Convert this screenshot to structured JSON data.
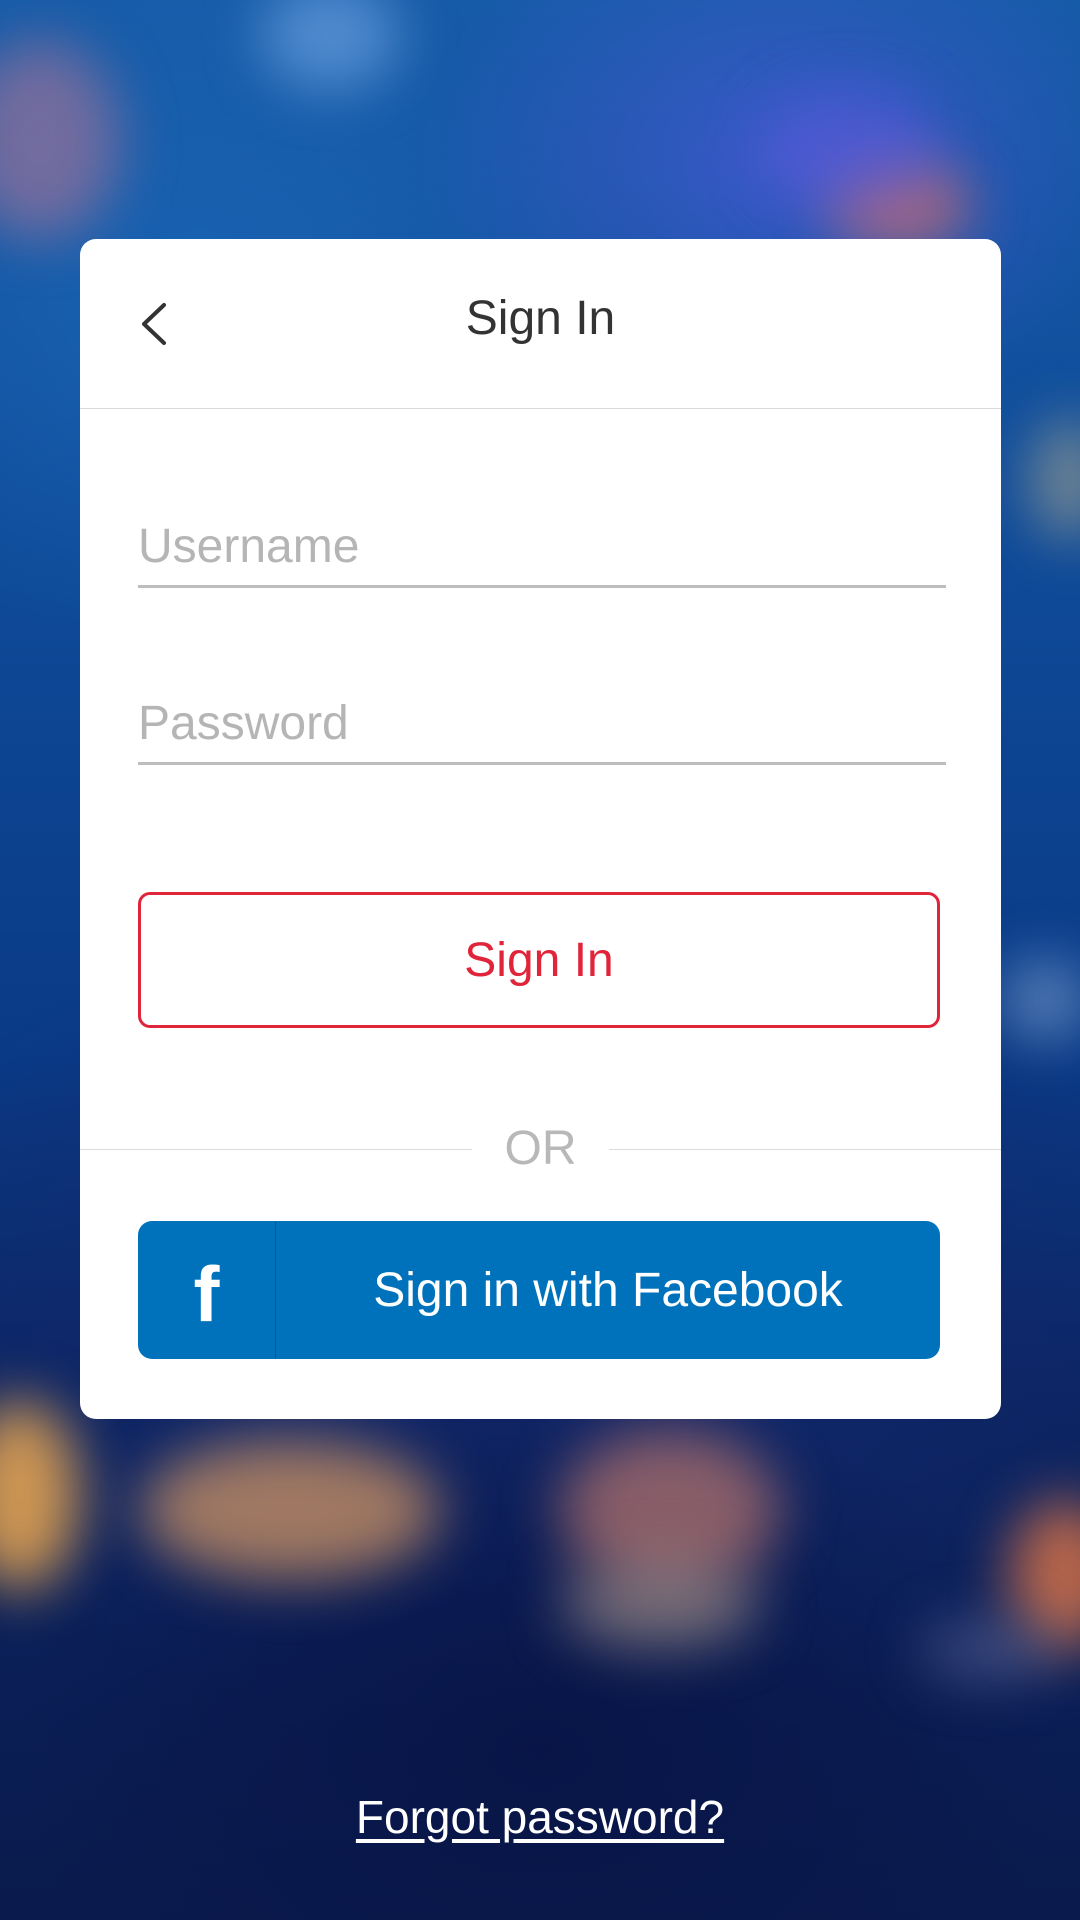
{
  "screen": {
    "title": "Sign In",
    "back_icon": "chevron-left-icon"
  },
  "form": {
    "username_placeholder": "Username",
    "password_placeholder": "Password",
    "signin_label": "Sign In",
    "divider_text": "OR",
    "facebook_label": "Sign in with Facebook",
    "facebook_icon_glyph": "f"
  },
  "footer": {
    "forgot_label": "Forgot password?"
  },
  "colors": {
    "accent_red": "#e0243a",
    "facebook_blue": "#0072bc",
    "card_bg": "#ffffff",
    "placeholder_gray": "#b5b5b5"
  }
}
